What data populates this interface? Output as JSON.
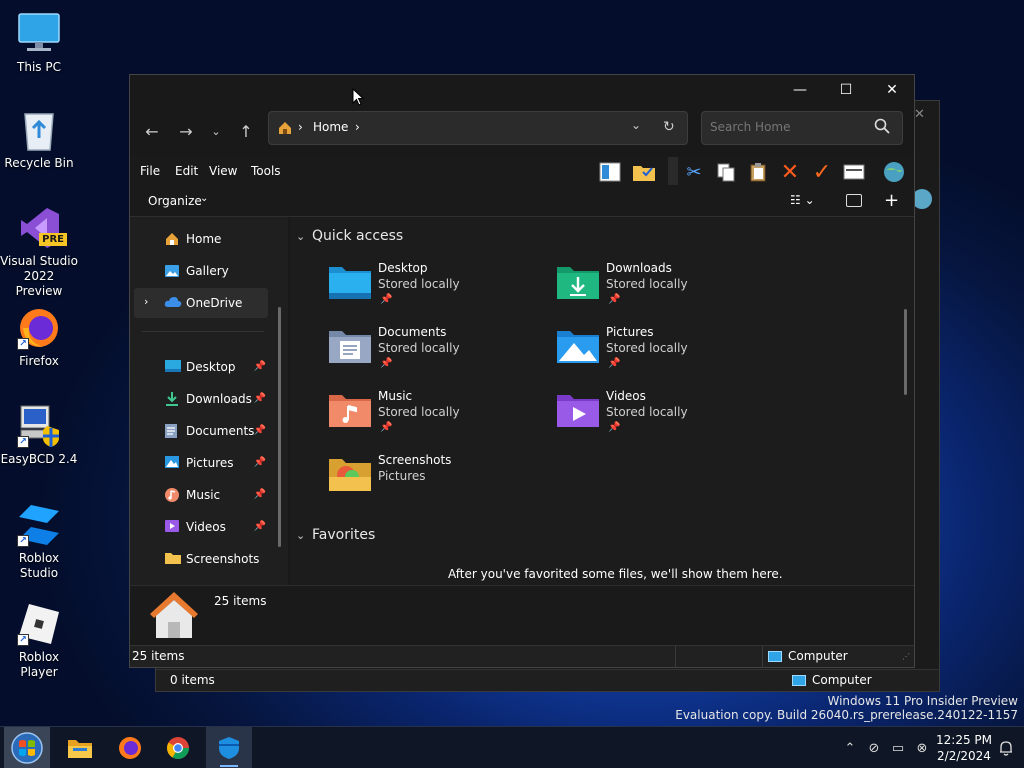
{
  "desktop": {
    "icons": [
      {
        "label": "This PC"
      },
      {
        "label": "Recycle Bin"
      },
      {
        "label": "Visual Studio 2022 Preview",
        "badge": "PRE"
      },
      {
        "label": "Firefox"
      },
      {
        "label": "EasyBCD 2.4"
      },
      {
        "label": "Roblox Studio"
      },
      {
        "label": "Roblox Player"
      }
    ]
  },
  "background_window": {
    "status_items": "0 items",
    "status_location": "Computer"
  },
  "explorer": {
    "address": {
      "crumb": "Home",
      "separator": "›"
    },
    "search": {
      "placeholder": "Search Home"
    },
    "menu": {
      "file": "File",
      "edit": "Edit",
      "view": "View",
      "tools": "Tools"
    },
    "commandbar": {
      "organize": "Organize"
    },
    "sidebar": {
      "top": [
        {
          "label": "Home"
        },
        {
          "label": "Gallery"
        },
        {
          "label": "OneDrive"
        }
      ],
      "pinned": [
        {
          "label": "Desktop"
        },
        {
          "label": "Downloads"
        },
        {
          "label": "Documents"
        },
        {
          "label": "Pictures"
        },
        {
          "label": "Music"
        },
        {
          "label": "Videos"
        },
        {
          "label": "Screenshots"
        }
      ]
    },
    "quick_access": {
      "title": "Quick access",
      "tiles": [
        {
          "name": "Desktop",
          "sub": "Stored locally"
        },
        {
          "name": "Downloads",
          "sub": "Stored locally"
        },
        {
          "name": "Documents",
          "sub": "Stored locally"
        },
        {
          "name": "Pictures",
          "sub": "Stored locally"
        },
        {
          "name": "Music",
          "sub": "Stored locally"
        },
        {
          "name": "Videos",
          "sub": "Stored locally"
        },
        {
          "name": "Screenshots",
          "sub": "Pictures"
        }
      ]
    },
    "favorites": {
      "title": "Favorites",
      "empty": "After you've favorited some files, we'll show them here."
    },
    "details": {
      "count": "25 items"
    },
    "status": {
      "items": "25 items",
      "location": "Computer"
    }
  },
  "watermark": {
    "line1": "Windows 11 Pro Insider Preview",
    "line2": "Evaluation copy. Build 26040.rs_prerelease.240122-1157"
  },
  "taskbar": {
    "time": "12:25 PM",
    "date": "2/2/2024"
  },
  "colors": {
    "accent": "#1e5fd6",
    "folder_yellow": "#f2c14e",
    "onedrive_blue": "#3b8fe8"
  }
}
